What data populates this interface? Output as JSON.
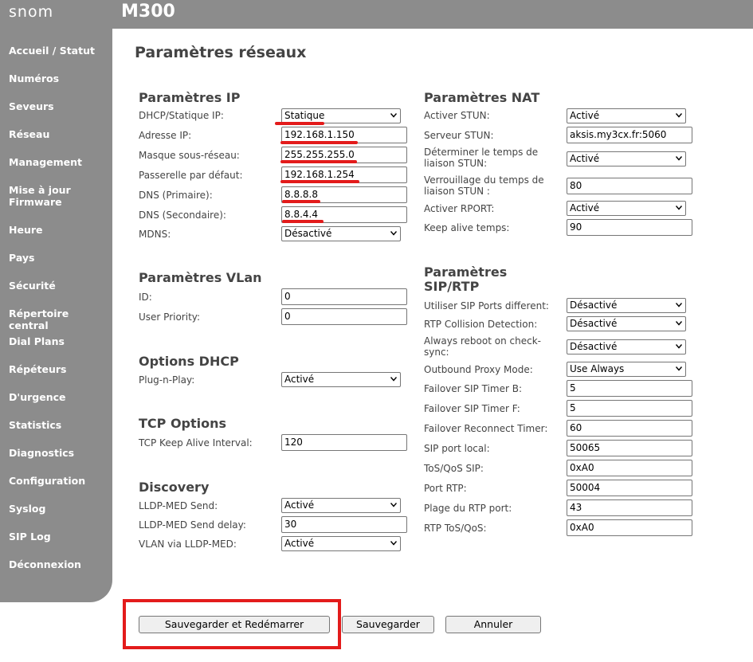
{
  "header": {
    "logo": "snom",
    "model": "M300"
  },
  "sidebar": {
    "items": [
      {
        "label": "Accueil / Statut"
      },
      {
        "label": "Numéros"
      },
      {
        "label": "Seveurs"
      },
      {
        "label": "Réseau"
      },
      {
        "label": "Management"
      },
      {
        "label": "Mise à jour Firmware"
      },
      {
        "label": "Heure"
      },
      {
        "label": "Pays"
      },
      {
        "label": "Sécurité"
      },
      {
        "label": "Répertoire central"
      },
      {
        "label": "Dial Plans"
      },
      {
        "label": "Répéteurs"
      },
      {
        "label": "D'urgence"
      },
      {
        "label": "Statistics"
      },
      {
        "label": "Diagnostics"
      },
      {
        "label": "Configuration"
      },
      {
        "label": "Syslog"
      },
      {
        "label": "SIP Log"
      },
      {
        "label": "Déconnexion"
      }
    ]
  },
  "page": {
    "title": "Paramètres réseaux"
  },
  "ip": {
    "title": "Paramètres IP",
    "dhcp_label": "DHCP/Statique IP:",
    "dhcp_value": "Statique",
    "ip_label": "Adresse IP:",
    "ip_value": "192.168.1.150",
    "mask_label": "Masque sous-réseau:",
    "mask_value": "255.255.255.0",
    "gateway_label": "Passerelle par défaut:",
    "gateway_value": "192.168.1.254",
    "dns1_label": "DNS (Primaire):",
    "dns1_value": "8.8.8.8",
    "dns2_label": "DNS (Secondaire):",
    "dns2_value": "8.8.4.4",
    "mdns_label": "MDNS:",
    "mdns_value": "Désactivé"
  },
  "vlan": {
    "title": "Paramètres VLan",
    "id_label": "ID:",
    "id_value": "0",
    "priority_label": "User Priority:",
    "priority_value": "0"
  },
  "dhcp_opts": {
    "title": "Options DHCP",
    "pnp_label": "Plug-n-Play:",
    "pnp_value": "Activé"
  },
  "tcp": {
    "title": "TCP Options",
    "keepalive_label": "TCP Keep Alive Interval:",
    "keepalive_value": "120"
  },
  "discovery": {
    "title": "Discovery",
    "lldp_send_label": "LLDP-MED Send:",
    "lldp_send_value": "Activé",
    "lldp_delay_label": "LLDP-MED Send delay:",
    "lldp_delay_value": "30",
    "vlan_lldp_label": "VLAN via LLDP-MED:",
    "vlan_lldp_value": "Activé"
  },
  "nat": {
    "title": "Paramètres NAT",
    "stun_label": "Activer STUN:",
    "stun_value": "Activé",
    "stun_server_label": "Serveur STUN:",
    "stun_server_value": "aksis.my3cx.fr:5060",
    "stun_bind_label": "Déterminer le temps de liaison STUN:",
    "stun_bind_value": "Activé",
    "stun_lock_label": "Verrouillage du temps de liaison STUN :",
    "stun_lock_value": "80",
    "rport_label": "Activer RPORT:",
    "rport_value": "Activé",
    "keepalive_label": "Keep alive temps:",
    "keepalive_value": "90"
  },
  "sip": {
    "title_line1": "Paramètres",
    "title_line2": "SIP/RTP",
    "sip_ports_label": "Utiliser SIP Ports different:",
    "sip_ports_value": "Désactivé",
    "rtp_collision_label": "RTP Collision Detection:",
    "rtp_collision_value": "Désactivé",
    "reboot_label": "Always reboot on check-sync:",
    "reboot_value": "Désactivé",
    "proxy_mode_label": "Outbound Proxy Mode:",
    "proxy_mode_value": "Use Always",
    "timer_b_label": "Failover SIP Timer B:",
    "timer_b_value": "5",
    "timer_f_label": "Failover SIP Timer F:",
    "timer_f_value": "5",
    "reconnect_label": "Failover Reconnect Timer:",
    "reconnect_value": "60",
    "sip_port_label": "SIP port local:",
    "sip_port_value": "50065",
    "tos_sip_label": "ToS/QoS SIP:",
    "tos_sip_value": "0xA0",
    "rtp_port_label": "Port RTP:",
    "rtp_port_value": "50004",
    "rtp_range_label": "Plage du RTP port:",
    "rtp_range_value": "43",
    "rtp_tos_label": "RTP ToS/QoS:",
    "rtp_tos_value": "0xA0"
  },
  "buttons": {
    "save_restart": "Sauvegarder et Redémarrer",
    "save": "Sauvegarder",
    "cancel": "Annuler"
  },
  "colors": {
    "chrome": "#8c8c8c",
    "annotation_red": "#e31b1b"
  },
  "icons": {
    "select": "chevron-down-icon"
  }
}
